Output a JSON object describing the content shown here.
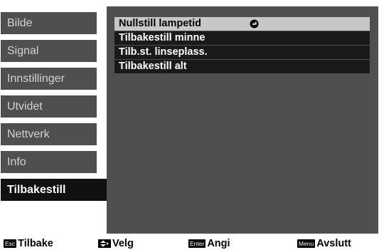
{
  "sidebar": {
    "items": [
      {
        "label": "Bilde"
      },
      {
        "label": "Signal"
      },
      {
        "label": "Innstillinger"
      },
      {
        "label": "Utvidet"
      },
      {
        "label": "Nettverk"
      },
      {
        "label": "Info"
      },
      {
        "label": "Tilbakestill"
      }
    ],
    "active_index": 6
  },
  "menu": {
    "items": [
      {
        "label": "Nullstill lampetid",
        "icon": "enter-icon"
      },
      {
        "label": "Tilbakestill minne"
      },
      {
        "label": "Tilb.st. linseplass."
      },
      {
        "label": "Tilbakestill alt"
      }
    ],
    "selected_index": 0
  },
  "footer": {
    "back": {
      "key": "Esc",
      "label": "Tilbake"
    },
    "select": {
      "key_icon": "up-down-arrow-icon",
      "label": "Velg"
    },
    "enter": {
      "key": "Enter",
      "label": "Angi"
    },
    "exit": {
      "key": "Menu",
      "label": "Avslutt"
    }
  },
  "colors": {
    "panel": "#4f4f4f",
    "item_bg": "#1a1a1a",
    "selected_bg": "#c7c7c7",
    "active_tab": "#111111"
  }
}
